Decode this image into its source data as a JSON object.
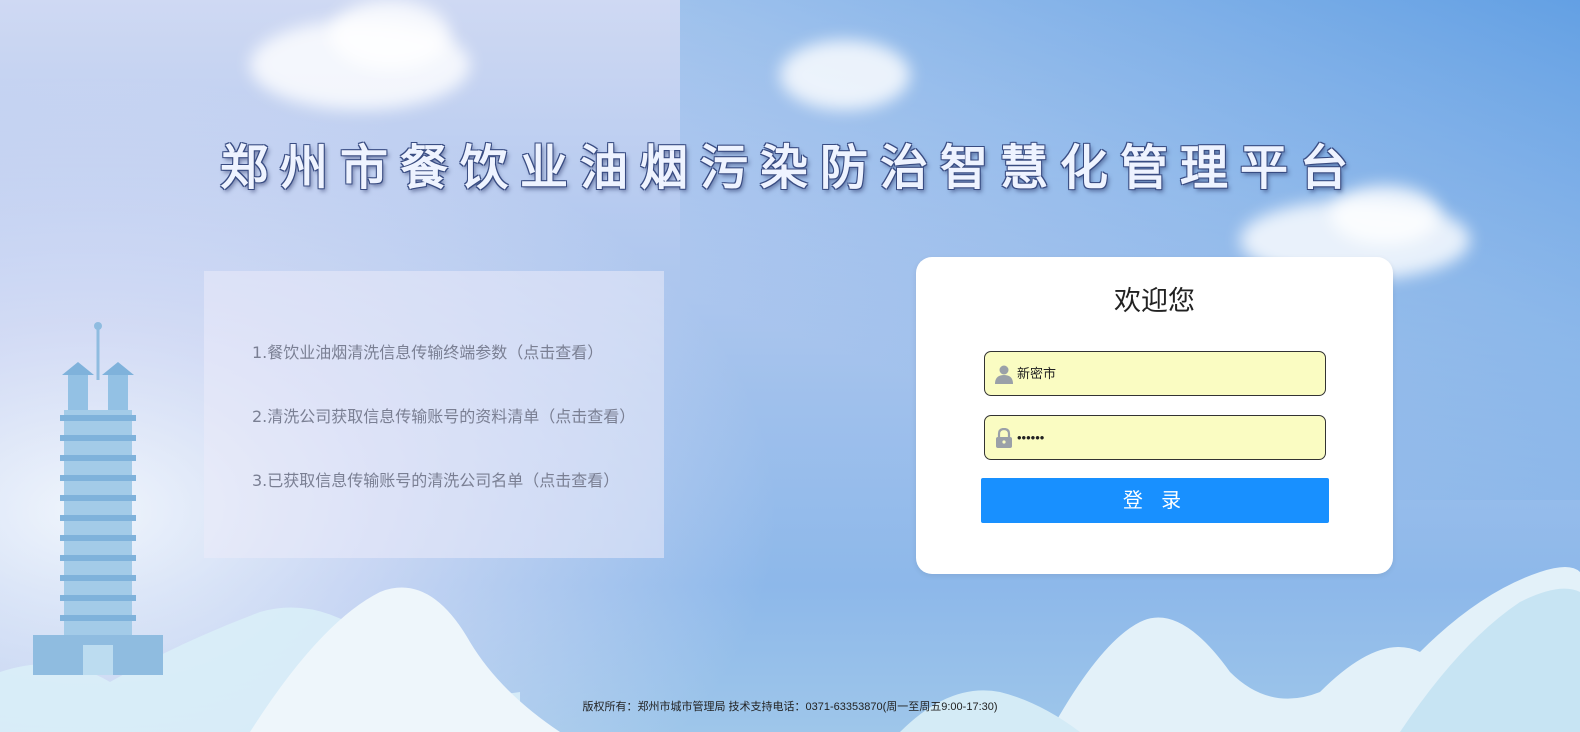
{
  "page": {
    "title": "郑州市餐饮业油烟污染防治智慧化管理平台"
  },
  "info_links": [
    {
      "label": "1.餐饮业油烟清洗信息传输终端参数（点击查看）"
    },
    {
      "label": "2.清洗公司获取信息传输账号的资料清单（点击查看）"
    },
    {
      "label": "3.已获取信息传输账号的清洗公司名单（点击查看）"
    }
  ],
  "login": {
    "welcome": "欢迎您",
    "username_value": "新密市",
    "password_value": "••••••",
    "submit_label": "登 录",
    "icons": {
      "username": "user-icon",
      "password": "lock-icon"
    }
  },
  "footer": {
    "text": "版权所有：郑州市城市管理局 技术支持电话：0371-63353870(周一至周五9:00-17:30)"
  },
  "colors": {
    "accent": "#1890ff",
    "input_bg": "#fafcc2",
    "link_text": "#7a7f93"
  }
}
